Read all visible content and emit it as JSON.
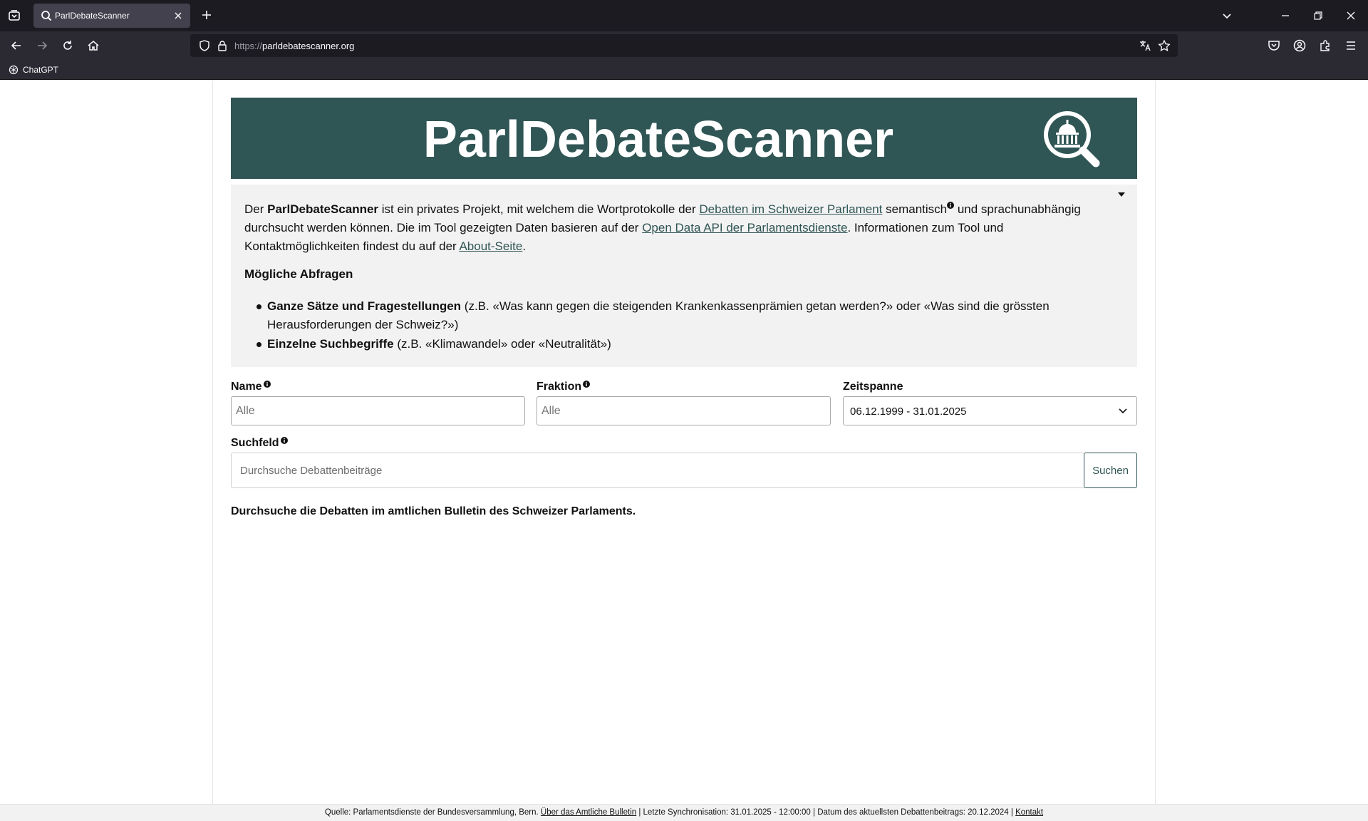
{
  "browser": {
    "tab_title": "ParlDebateScanner",
    "url_scheme": "https://",
    "url_host": "parldebatescanner.org",
    "bookmark_label": "ChatGPT"
  },
  "banner": {
    "title": "ParlDebateScanner",
    "color": "#2f5554"
  },
  "intro": {
    "p_der": "Der ",
    "p_brand": "ParlDebateScanner",
    "p_mid1": " ist ein privates Projekt, mit welchem die Wortprotokolle der ",
    "p_link1": "Debatten im Schweizer Parlament",
    "p_mid2": " semantisch",
    "p_mid3": " und sprachunabhängig durchsucht werden können. Die im Tool gezeigten Daten basieren auf der ",
    "p_link2": "Open Data API der Parlamentsdienste",
    "p_mid4": ". Informationen zum Tool und Kontaktmöglichkeiten findest du auf der ",
    "p_link3": "About-Seite",
    "p_end": ".",
    "heading": "Mögliche Abfragen",
    "items": [
      {
        "bold": "Ganze Sätze und Fragestellungen",
        "rest": " (z.B. «Was kann gegen die steigenden Krankenkassenprämien getan werden?» oder «Was sind die grössten Herausforderungen der Schweiz?»)"
      },
      {
        "bold": "Einzelne Suchbegriffe",
        "rest": " (z.B. «Klimawandel» oder «Neutralität»)"
      }
    ]
  },
  "filters": {
    "name_label": "Name",
    "name_placeholder": "Alle",
    "fraktion_label": "Fraktion",
    "fraktion_placeholder": "Alle",
    "zeitspanne_label": "Zeitspanne",
    "zeitspanne_value": "06.12.1999 - 31.01.2025"
  },
  "search": {
    "label": "Suchfeld",
    "placeholder": "Durchsuche Debattenbeiträge",
    "button": "Suchen"
  },
  "tagline": "Durchsuche die Debatten im amtlichen Bulletin des Schweizer Parlaments.",
  "footer": {
    "source": "Quelle: Parlamentsdienste der Bundesversammlung, Bern. ",
    "link_bulletin": "Über das Amtliche Bulletin",
    "sync": " | Letzte Synchronisation: 31.01.2025 - 12:00:00 | Datum des aktuellsten Debattenbeitrags: 20.12.2024 | ",
    "link_contact": "Kontakt"
  }
}
